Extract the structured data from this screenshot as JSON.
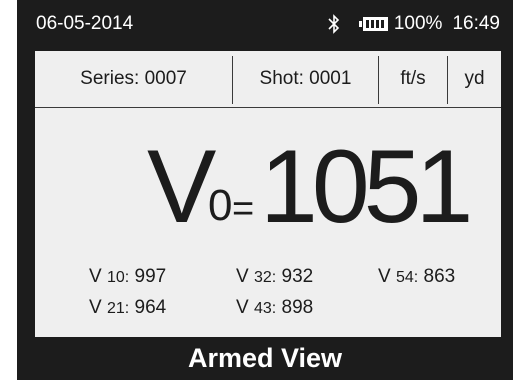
{
  "status": {
    "date": "06-05-2014",
    "battery": "100%",
    "time": "16:49",
    "icons": [
      "bluetooth-icon",
      "battery-icon"
    ]
  },
  "info": {
    "series": "Series: 0007",
    "shot": "Shot: 0001",
    "speed_unit": "ft/s",
    "distance_unit": "yd"
  },
  "reading": {
    "symbol": "V",
    "subscript": "0",
    "equals": "=",
    "value": "1051"
  },
  "velocities": [
    {
      "prefix": "V",
      "sub": "10:",
      "value": "997"
    },
    {
      "prefix": "V",
      "sub": "21:",
      "value": "964"
    },
    {
      "prefix": "V",
      "sub": "32:",
      "value": "932"
    },
    {
      "prefix": "V",
      "sub": "43:",
      "value": "898"
    },
    {
      "prefix": "V",
      "sub": "54:",
      "value": "863"
    }
  ],
  "footer": {
    "title": "Armed View"
  },
  "colors": {
    "frame": "#1c1c1c",
    "screen": "#efefef",
    "text": "#1c1c1c"
  }
}
